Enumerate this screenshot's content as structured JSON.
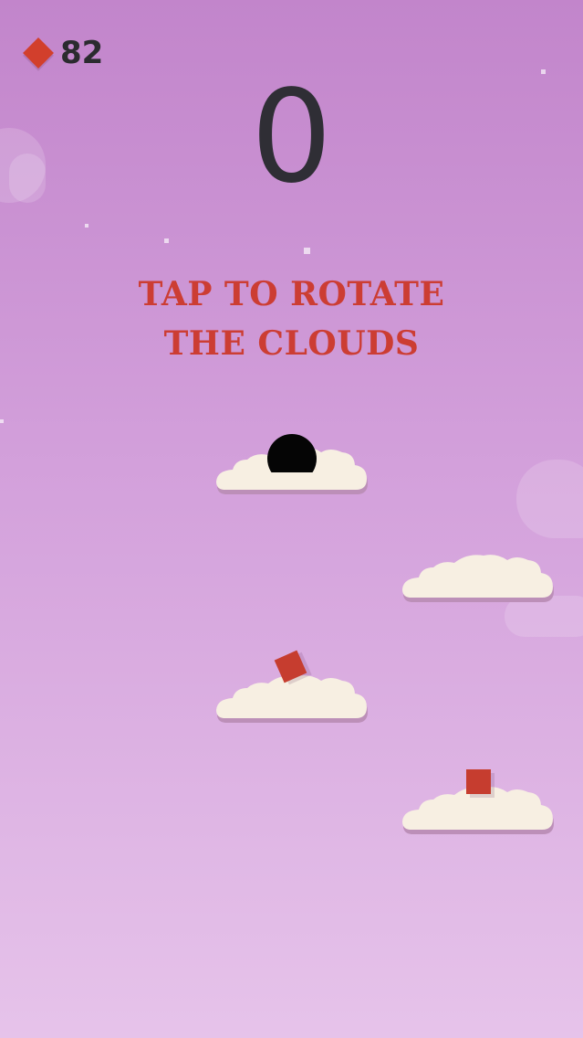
{
  "hud": {
    "gem_count": "82",
    "score": "0"
  },
  "instructions": {
    "line1": "TAP TO ROTATE",
    "line2": "THE CLOUDS"
  },
  "colors": {
    "background_top": "#c285cb",
    "background_bottom": "#e6c3ea",
    "cloud": "#f7efe2",
    "cloud_shadow": "#bc8fb8",
    "accent_red": "#cc3d33",
    "text_dark": "#2f2e35",
    "ball": "#050505"
  },
  "icons": {
    "gem": "red-diamond-icon"
  }
}
